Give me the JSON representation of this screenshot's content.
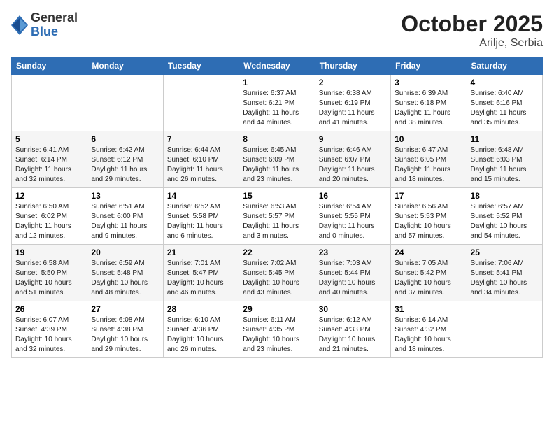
{
  "header": {
    "logo": {
      "general": "General",
      "blue": "Blue"
    },
    "title": "October 2025",
    "subtitle": "Arilje, Serbia"
  },
  "calendar": {
    "weekdays": [
      "Sunday",
      "Monday",
      "Tuesday",
      "Wednesday",
      "Thursday",
      "Friday",
      "Saturday"
    ],
    "weeks": [
      [
        {
          "day": null,
          "info": null
        },
        {
          "day": null,
          "info": null
        },
        {
          "day": null,
          "info": null
        },
        {
          "day": "1",
          "info": "Sunrise: 6:37 AM\nSunset: 6:21 PM\nDaylight: 11 hours\nand 44 minutes."
        },
        {
          "day": "2",
          "info": "Sunrise: 6:38 AM\nSunset: 6:19 PM\nDaylight: 11 hours\nand 41 minutes."
        },
        {
          "day": "3",
          "info": "Sunrise: 6:39 AM\nSunset: 6:18 PM\nDaylight: 11 hours\nand 38 minutes."
        },
        {
          "day": "4",
          "info": "Sunrise: 6:40 AM\nSunset: 6:16 PM\nDaylight: 11 hours\nand 35 minutes."
        }
      ],
      [
        {
          "day": "5",
          "info": "Sunrise: 6:41 AM\nSunset: 6:14 PM\nDaylight: 11 hours\nand 32 minutes."
        },
        {
          "day": "6",
          "info": "Sunrise: 6:42 AM\nSunset: 6:12 PM\nDaylight: 11 hours\nand 29 minutes."
        },
        {
          "day": "7",
          "info": "Sunrise: 6:44 AM\nSunset: 6:10 PM\nDaylight: 11 hours\nand 26 minutes."
        },
        {
          "day": "8",
          "info": "Sunrise: 6:45 AM\nSunset: 6:09 PM\nDaylight: 11 hours\nand 23 minutes."
        },
        {
          "day": "9",
          "info": "Sunrise: 6:46 AM\nSunset: 6:07 PM\nDaylight: 11 hours\nand 20 minutes."
        },
        {
          "day": "10",
          "info": "Sunrise: 6:47 AM\nSunset: 6:05 PM\nDaylight: 11 hours\nand 18 minutes."
        },
        {
          "day": "11",
          "info": "Sunrise: 6:48 AM\nSunset: 6:03 PM\nDaylight: 11 hours\nand 15 minutes."
        }
      ],
      [
        {
          "day": "12",
          "info": "Sunrise: 6:50 AM\nSunset: 6:02 PM\nDaylight: 11 hours\nand 12 minutes."
        },
        {
          "day": "13",
          "info": "Sunrise: 6:51 AM\nSunset: 6:00 PM\nDaylight: 11 hours\nand 9 minutes."
        },
        {
          "day": "14",
          "info": "Sunrise: 6:52 AM\nSunset: 5:58 PM\nDaylight: 11 hours\nand 6 minutes."
        },
        {
          "day": "15",
          "info": "Sunrise: 6:53 AM\nSunset: 5:57 PM\nDaylight: 11 hours\nand 3 minutes."
        },
        {
          "day": "16",
          "info": "Sunrise: 6:54 AM\nSunset: 5:55 PM\nDaylight: 11 hours\nand 0 minutes."
        },
        {
          "day": "17",
          "info": "Sunrise: 6:56 AM\nSunset: 5:53 PM\nDaylight: 10 hours\nand 57 minutes."
        },
        {
          "day": "18",
          "info": "Sunrise: 6:57 AM\nSunset: 5:52 PM\nDaylight: 10 hours\nand 54 minutes."
        }
      ],
      [
        {
          "day": "19",
          "info": "Sunrise: 6:58 AM\nSunset: 5:50 PM\nDaylight: 10 hours\nand 51 minutes."
        },
        {
          "day": "20",
          "info": "Sunrise: 6:59 AM\nSunset: 5:48 PM\nDaylight: 10 hours\nand 48 minutes."
        },
        {
          "day": "21",
          "info": "Sunrise: 7:01 AM\nSunset: 5:47 PM\nDaylight: 10 hours\nand 46 minutes."
        },
        {
          "day": "22",
          "info": "Sunrise: 7:02 AM\nSunset: 5:45 PM\nDaylight: 10 hours\nand 43 minutes."
        },
        {
          "day": "23",
          "info": "Sunrise: 7:03 AM\nSunset: 5:44 PM\nDaylight: 10 hours\nand 40 minutes."
        },
        {
          "day": "24",
          "info": "Sunrise: 7:05 AM\nSunset: 5:42 PM\nDaylight: 10 hours\nand 37 minutes."
        },
        {
          "day": "25",
          "info": "Sunrise: 7:06 AM\nSunset: 5:41 PM\nDaylight: 10 hours\nand 34 minutes."
        }
      ],
      [
        {
          "day": "26",
          "info": "Sunrise: 6:07 AM\nSunset: 4:39 PM\nDaylight: 10 hours\nand 32 minutes."
        },
        {
          "day": "27",
          "info": "Sunrise: 6:08 AM\nSunset: 4:38 PM\nDaylight: 10 hours\nand 29 minutes."
        },
        {
          "day": "28",
          "info": "Sunrise: 6:10 AM\nSunset: 4:36 PM\nDaylight: 10 hours\nand 26 minutes."
        },
        {
          "day": "29",
          "info": "Sunrise: 6:11 AM\nSunset: 4:35 PM\nDaylight: 10 hours\nand 23 minutes."
        },
        {
          "day": "30",
          "info": "Sunrise: 6:12 AM\nSunset: 4:33 PM\nDaylight: 10 hours\nand 21 minutes."
        },
        {
          "day": "31",
          "info": "Sunrise: 6:14 AM\nSunset: 4:32 PM\nDaylight: 10 hours\nand 18 minutes."
        },
        {
          "day": null,
          "info": null
        }
      ]
    ]
  }
}
